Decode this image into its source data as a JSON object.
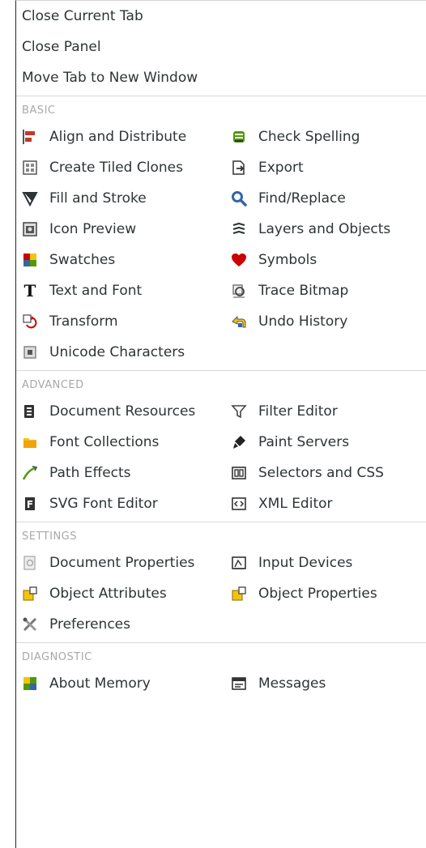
{
  "top_items": [
    {
      "label": "Close Current Tab"
    },
    {
      "label": "Close Panel"
    },
    {
      "label": "Move Tab to New Window"
    }
  ],
  "sections": [
    {
      "header": "BASIC",
      "items": [
        {
          "label": "Align and Distribute",
          "icon": "align-icon"
        },
        {
          "label": "Check Spelling",
          "icon": "spellcheck-icon"
        },
        {
          "label": "Create Tiled Clones",
          "icon": "tiled-clones-icon"
        },
        {
          "label": "Export",
          "icon": "export-icon"
        },
        {
          "label": "Fill and Stroke",
          "icon": "fill-stroke-icon"
        },
        {
          "label": "Find/Replace",
          "icon": "search-icon"
        },
        {
          "label": "Icon Preview",
          "icon": "icon-preview-icon"
        },
        {
          "label": "Layers and Objects",
          "icon": "layers-icon"
        },
        {
          "label": "Swatches",
          "icon": "swatches-icon"
        },
        {
          "label": "Symbols",
          "icon": "heart-icon"
        },
        {
          "label": "Text and Font",
          "icon": "text-icon"
        },
        {
          "label": "Trace Bitmap",
          "icon": "trace-bitmap-icon"
        },
        {
          "label": "Transform",
          "icon": "transform-icon"
        },
        {
          "label": "Undo History",
          "icon": "undo-history-icon"
        },
        {
          "label": "Unicode Characters",
          "icon": "unicode-icon"
        }
      ]
    },
    {
      "header": "ADVANCED",
      "items": [
        {
          "label": "Document Resources",
          "icon": "document-resources-icon"
        },
        {
          "label": "Filter Editor",
          "icon": "filter-icon"
        },
        {
          "label": "Font Collections",
          "icon": "font-collections-icon"
        },
        {
          "label": "Paint Servers",
          "icon": "paint-servers-icon"
        },
        {
          "label": "Path Effects",
          "icon": "path-effects-icon"
        },
        {
          "label": "Selectors and CSS",
          "icon": "selectors-css-icon"
        },
        {
          "label": "SVG Font Editor",
          "icon": "svg-font-editor-icon"
        },
        {
          "label": "XML Editor",
          "icon": "xml-editor-icon"
        }
      ]
    },
    {
      "header": "SETTINGS",
      "items": [
        {
          "label": "Document Properties",
          "icon": "document-properties-icon"
        },
        {
          "label": "Input Devices",
          "icon": "input-devices-icon"
        },
        {
          "label": "Object Attributes",
          "icon": "object-attributes-icon"
        },
        {
          "label": "Object Properties",
          "icon": "object-properties-icon"
        },
        {
          "label": "Preferences",
          "icon": "preferences-icon"
        }
      ]
    },
    {
      "header": "DIAGNOSTIC",
      "items": [
        {
          "label": "About Memory",
          "icon": "memory-icon"
        },
        {
          "label": "Messages",
          "icon": "messages-icon"
        }
      ]
    }
  ]
}
